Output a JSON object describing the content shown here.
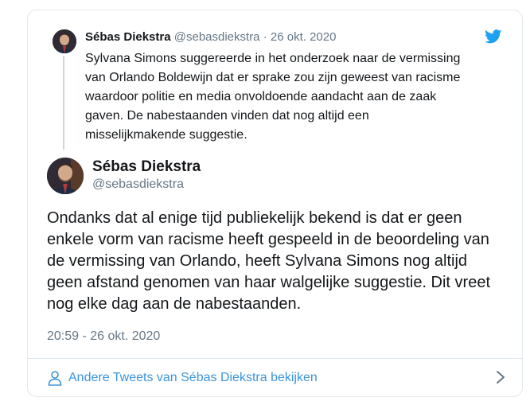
{
  "reply": {
    "name": "Sébas Diekstra",
    "handle": "@sebasdiekstra",
    "separator": "·",
    "date": "26 okt. 2020",
    "lines": [
      "Sylvana Simons suggereerde in het onderzoek naar de vermissing",
      "van Orlando Boldewijn dat er sprake zou zijn geweest van racisme",
      "waardoor politie en media onvoldoende aandacht aan de zaak",
      "gaven. De nabestaanden vinden dat nog altijd een",
      "misselijkmakende suggestie."
    ]
  },
  "tweet": {
    "name": "Sébas Diekstra",
    "handle": "@sebasdiekstra",
    "lines": [
      "Ondanks dat al enige tijd publiekelijk bekend is dat er geen",
      "enkele vorm van racisme heeft gespeeld in de beoordeling van",
      "de vermissing van Orlando, heeft Sylvana Simons nog altijd",
      "geen afstand genomen van haar walgelijke suggestie. Dit vreet",
      "nog elke dag aan de nabestaanden."
    ],
    "timestamp": "20:59 - 26 okt. 2020"
  },
  "footer": {
    "label": "Andere Tweets van Sébas Diekstra bekijken"
  },
  "icons": {
    "brand": "twitter-bird-icon",
    "footer": "person-icon",
    "more": "chevron-right-icon"
  },
  "colors": {
    "twitter_blue": "#1da1f2",
    "link_blue": "#3b94d9",
    "muted_text": "#657786",
    "border": "#e1e8ed"
  }
}
